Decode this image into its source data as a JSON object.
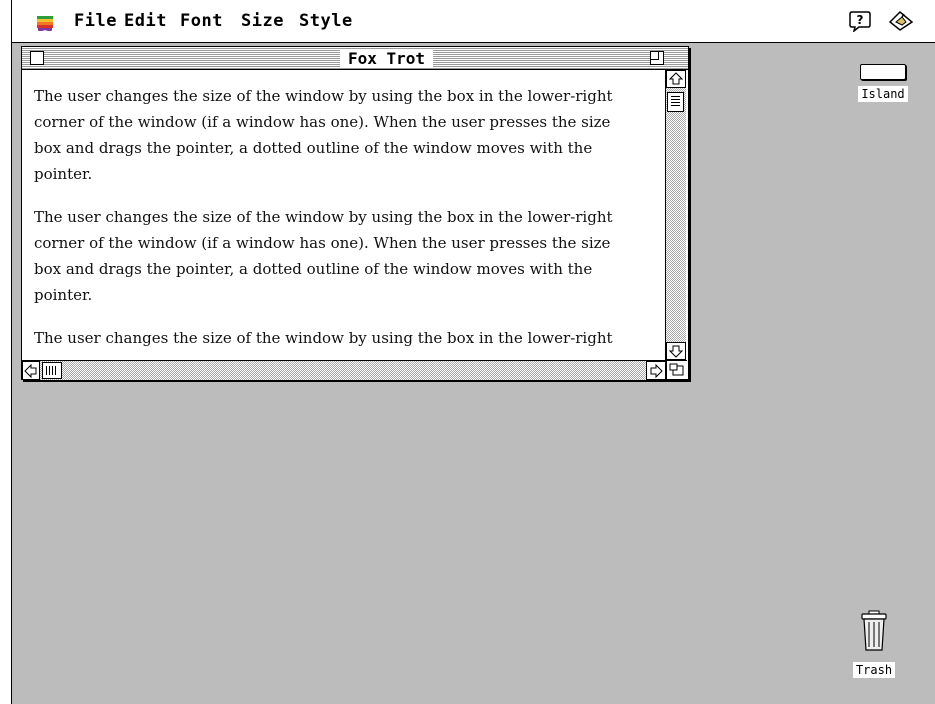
{
  "menubar": {
    "apple_icon": "apple-icon",
    "items": [
      "File",
      "Edit",
      "Font",
      "Size",
      "Style"
    ],
    "help_icon": "help-balloon-icon",
    "app_icon": "application-icon"
  },
  "window": {
    "title": "Fox Trot",
    "paragraphs": [
      [
        "The user changes the size of the window by using the box in the lower-right",
        "corner of the window (if a window has one). When the user presses the size",
        "box and drags the pointer, a dotted outline of the window moves with the",
        "pointer."
      ],
      [
        "The user changes the size of the window by using the box in the lower-right",
        "corner of the window (if a window has one). When the user presses the size",
        "box and drags the pointer, a dotted outline of the window moves with the",
        "pointer."
      ],
      [
        "The user changes the size of the window by using the box in the lower-right"
      ]
    ]
  },
  "desktop": {
    "icons": [
      {
        "label": "Island",
        "icon": "disk-icon"
      },
      {
        "label": "Trash",
        "icon": "trash-icon"
      }
    ]
  },
  "colors": {
    "desktop": "#bcbcbc",
    "menubar": "#ffffff",
    "window": "#ffffff",
    "text": "#111111"
  }
}
